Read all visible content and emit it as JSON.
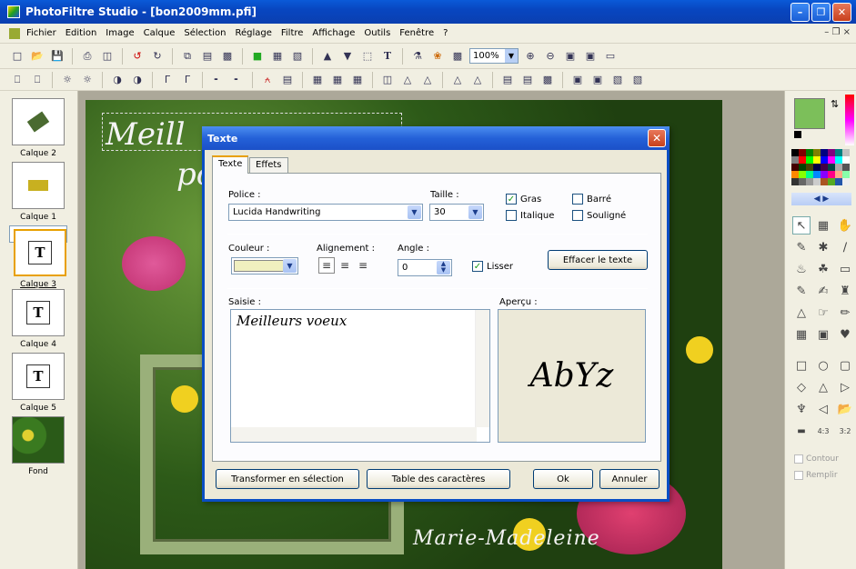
{
  "window": {
    "title": "PhotoFiltre Studio - [bon2009mm.pfi]"
  },
  "menu": [
    "Fichier",
    "Edition",
    "Image",
    "Calque",
    "Sélection",
    "Réglage",
    "Filtre",
    "Affichage",
    "Outils",
    "Fenêtre",
    "?"
  ],
  "toolbar": {
    "zoom": "100%"
  },
  "layers": [
    {
      "label": "Calque 2"
    },
    {
      "label": "Calque 1"
    },
    {
      "label": "Calque 3"
    },
    {
      "label": "Calque 4"
    },
    {
      "label": "Calque 5"
    },
    {
      "label": "Fond"
    }
  ],
  "canvas": {
    "line1": "Meill",
    "line2": "pou",
    "signature": "Marie-Madeleine"
  },
  "palette": {
    "outline": "Contour",
    "fill": "Remplir",
    "fg_color": "#7cbf5a",
    "bg_color": "#ffffff"
  },
  "dialog": {
    "title": "Texte",
    "tabs": [
      "Texte",
      "Effets"
    ],
    "font_label": "Police :",
    "font_value": "Lucida Handwriting",
    "size_label": "Taille :",
    "size_value": "30",
    "bold": "Gras",
    "italic": "Italique",
    "strike": "Barré",
    "underline": "Souligné",
    "color_label": "Couleur :",
    "align_label": "Alignement :",
    "angle_label": "Angle :",
    "angle_value": "0",
    "smooth": "Lisser",
    "clear_button": "Effacer le texte",
    "input_label": "Saisie :",
    "input_text": "Meilleurs voeux",
    "preview_label": "Aperçu :",
    "preview_text": "AbYz",
    "transform_button": "Transformer en sélection",
    "charmap_button": "Table des caractères",
    "ok_button": "Ok",
    "cancel_button": "Annuler",
    "text_color": "#f0efbf"
  }
}
